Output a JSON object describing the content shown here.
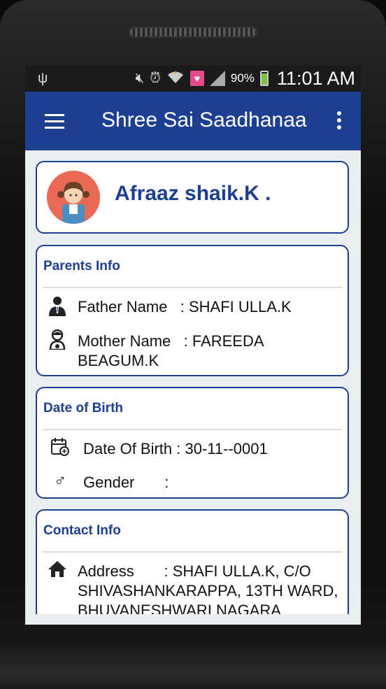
{
  "statusbar": {
    "battery_pct": "90%",
    "time": "11:01 AM",
    "icons": [
      "usb-icon",
      "mute-icon",
      "alarm-icon",
      "wifi-icon",
      "heart-app-icon",
      "signal-icon",
      "battery-icon"
    ]
  },
  "appbar": {
    "title": "Shree Sai Saadhanaa"
  },
  "profile": {
    "name": "Afraaz shaik.K ."
  },
  "parents": {
    "title": "Parents Info",
    "father_label": "Father Name",
    "father_value": ": SHAFI ULLA.K",
    "mother_label": "Mother Name",
    "mother_value": ": FAREEDA",
    "mother_value_line2": "BEAGUM.K"
  },
  "dob": {
    "title": "Date of Birth",
    "dob_text": "Date Of Birth : 30-11--0001",
    "gender_label": "Gender",
    "gender_value": ":"
  },
  "contact": {
    "title": "Contact Info",
    "address_label": "Address",
    "address_line1": ": SHAFI ULLA.K, C/O",
    "address_line2": "SHIVASHANKARAPPA, 13TH WARD,",
    "address_line3": "BHUVANESHWARI NAGARA"
  },
  "colors": {
    "primary": "#1c3f91",
    "background": "#e9eef1",
    "avatar_bg": "#e86a55"
  }
}
